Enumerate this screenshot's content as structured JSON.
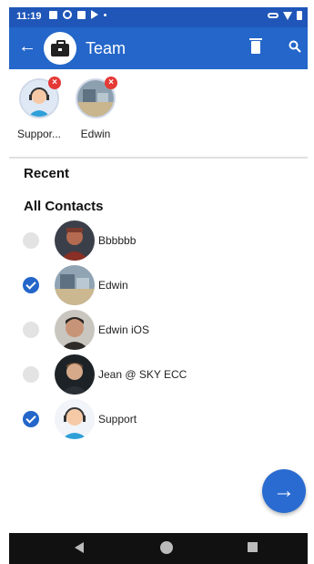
{
  "status_bar": {
    "time": "11:19"
  },
  "app_bar": {
    "title": "Team"
  },
  "selected": [
    {
      "label": "Suppor..."
    },
    {
      "label": "Edwin"
    }
  ],
  "sections": {
    "recent": "Recent",
    "all_contacts": "All Contacts"
  },
  "contacts": [
    {
      "name": "Bbbbbb",
      "checked": false
    },
    {
      "name": "Edwin",
      "checked": true
    },
    {
      "name": "Edwin iOS",
      "checked": false
    },
    {
      "name": "Jean @ SKY ECC",
      "checked": false
    },
    {
      "name": "Support",
      "checked": true
    }
  ],
  "colors": {
    "accent": "#2466c9",
    "status_bar": "#1f56b8",
    "remove_badge": "#e53935"
  },
  "icons": {
    "back": "arrow-left-icon",
    "group": "briefcase-icon",
    "delete": "trash-icon",
    "search": "search-icon",
    "next": "arrow-right-icon"
  }
}
